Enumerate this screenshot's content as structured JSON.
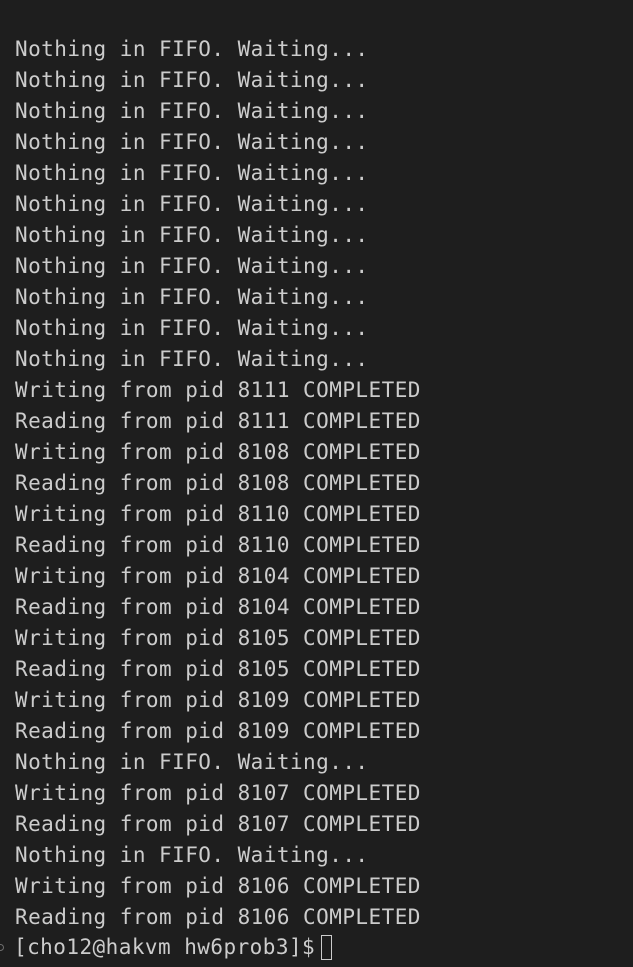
{
  "terminal": {
    "lines": [
      "Nothing in FIFO. Waiting...",
      "Nothing in FIFO. Waiting...",
      "Nothing in FIFO. Waiting...",
      "Nothing in FIFO. Waiting...",
      "Nothing in FIFO. Waiting...",
      "Nothing in FIFO. Waiting...",
      "Nothing in FIFO. Waiting...",
      "Nothing in FIFO. Waiting...",
      "Nothing in FIFO. Waiting...",
      "Nothing in FIFO. Waiting...",
      "Nothing in FIFO. Waiting...",
      "Writing from pid 8111 COMPLETED",
      "Reading from pid 8111 COMPLETED",
      "Writing from pid 8108 COMPLETED",
      "Reading from pid 8108 COMPLETED",
      "Writing from pid 8110 COMPLETED",
      "Reading from pid 8110 COMPLETED",
      "Writing from pid 8104 COMPLETED",
      "Reading from pid 8104 COMPLETED",
      "Writing from pid 8105 COMPLETED",
      "Reading from pid 8105 COMPLETED",
      "Writing from pid 8109 COMPLETED",
      "Reading from pid 8109 COMPLETED",
      "Nothing in FIFO. Waiting...",
      "Writing from pid 8107 COMPLETED",
      "Reading from pid 8107 COMPLETED",
      "Nothing in FIFO. Waiting...",
      "Writing from pid 8106 COMPLETED",
      "Reading from pid 8106 COMPLETED"
    ],
    "prompt": "[cho12@hakvm hw6prob3]$",
    "colors": {
      "background": "#1e1e1e",
      "foreground": "#cccccc"
    }
  }
}
